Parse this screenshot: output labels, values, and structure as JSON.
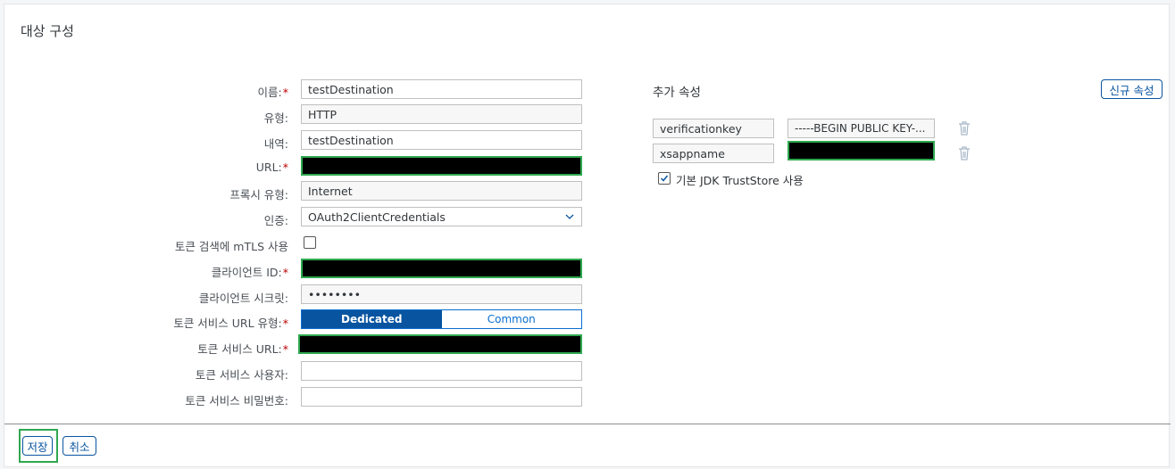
{
  "page": {
    "title": "대상 구성"
  },
  "form": {
    "name_label": "이름:",
    "name_value": "testDestination",
    "type_label": "유형:",
    "type_value": "HTTP",
    "desc_label": "내역:",
    "desc_value": "testDestination",
    "url_label": "URL:",
    "proxy_label": "프록시 유형:",
    "proxy_value": "Internet",
    "auth_label": "인증:",
    "auth_value": "OAuth2ClientCredentials",
    "mtls_label": "토큰 검색에 mTLS 사용",
    "mtls_checked": false,
    "client_id_label": "클라이언트 ID:",
    "client_secret_label": "클라이언트 시크릿:",
    "client_secret_value": "••••••••",
    "token_url_type_label": "토큰 서비스 URL 유형:",
    "token_url_type_options": [
      "Dedicated",
      "Common"
    ],
    "token_url_type_selected": "Dedicated",
    "token_url_label": "토큰 서비스 URL:",
    "token_user_label": "토큰 서비스 사용자:",
    "token_user_value": "",
    "token_password_label": "토큰 서비스 비밀번호:",
    "token_password_value": "",
    "required_mark": "*"
  },
  "additional": {
    "title": "추가 속성",
    "new_button": "신규 속성",
    "properties": [
      {
        "key": "verificationkey",
        "value": "-----BEGIN PUBLIC KEY-..."
      },
      {
        "key": "xsappname",
        "value": ""
      }
    ],
    "truststore_label": "기본 JDK TrustStore 사용",
    "truststore_checked": true
  },
  "footer": {
    "save_label": "저장",
    "cancel_label": "취소"
  },
  "colors": {
    "accent": "#0854a0",
    "required": "#bb0000",
    "highlight": "#2fa84f"
  }
}
